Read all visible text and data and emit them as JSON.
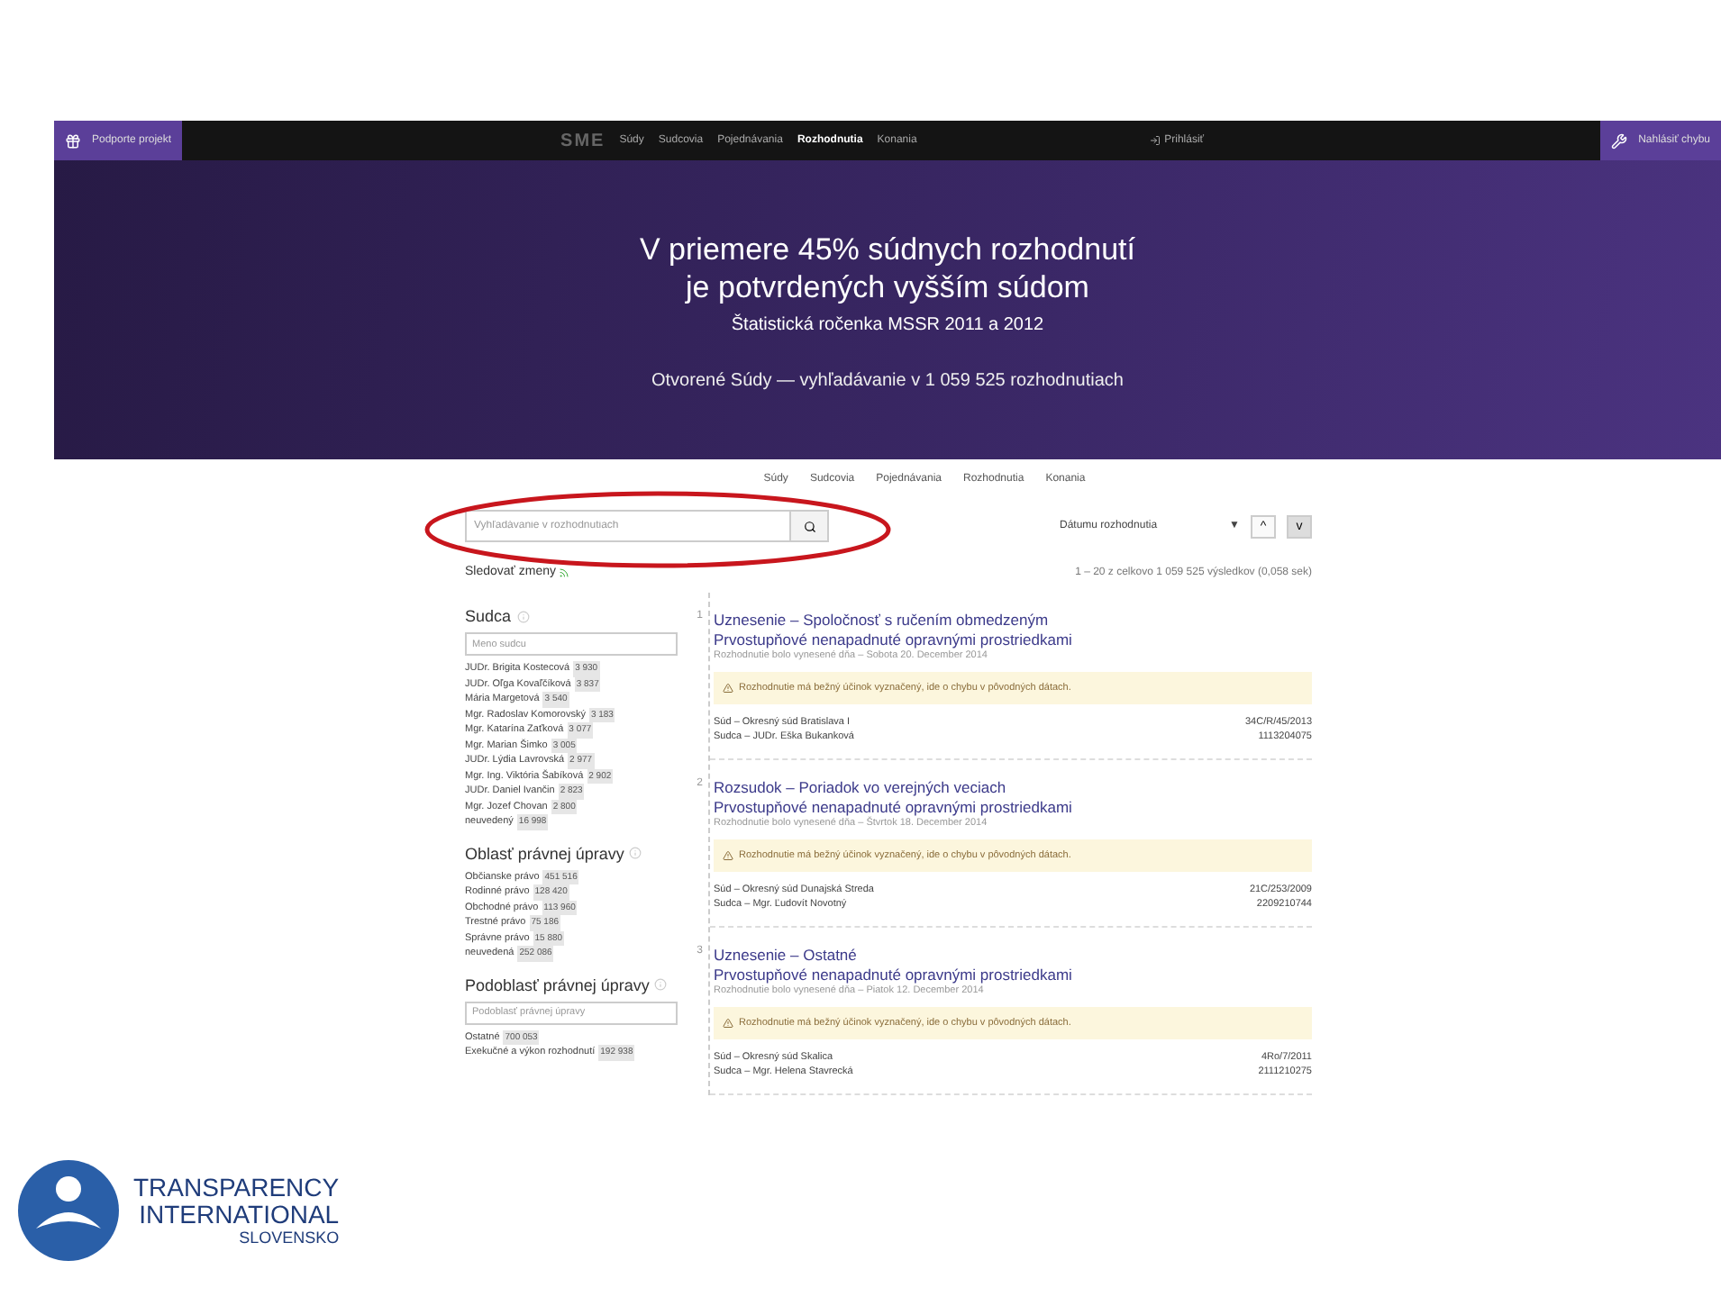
{
  "topbar": {
    "support_button": "Podporte projekt",
    "logo": "SME",
    "nav": [
      {
        "label": "Súdy",
        "selected": false
      },
      {
        "label": "Sudcovia",
        "selected": false
      },
      {
        "label": "Pojednávania",
        "selected": false
      },
      {
        "label": "Rozhodnutia",
        "selected": true
      },
      {
        "label": "Konania",
        "selected": false
      }
    ],
    "login": "Prihlásiť",
    "report_button": "Nahlásiť chybu"
  },
  "hero": {
    "title_lines": [
      "V priemere 45% súdnych rozhodnutí",
      "je potvrdených vyšším súdom"
    ],
    "source": "Štatistická ročenka MSSR 2011 a 2012",
    "tagline": "Otvorené Súdy — vyhľadávanie v 1 059 525 rozhodnutiach"
  },
  "subnav": [
    {
      "label": "Súdy",
      "selected": false
    },
    {
      "label": "Sudcovia",
      "selected": false
    },
    {
      "label": "Pojednávania",
      "selected": false
    },
    {
      "label": "Rozhodnutia",
      "selected": false
    },
    {
      "label": "Konania",
      "selected": false
    }
  ],
  "search": {
    "placeholder": "Vyhľadávanie v rozhodnutiach",
    "follow": "Sledovať zmeny"
  },
  "sort": {
    "value": "Dátumu rozhodnutia",
    "caret": "▼",
    "directions": [
      {
        "label": "^",
        "selected": false
      },
      {
        "label": "v",
        "selected": true
      }
    ]
  },
  "result_count": "1 – 20 z celkovo 1 059 525 výsledkov (0,058 sek)",
  "facets": [
    {
      "title": "Sudca",
      "placeholder": "Meno sudcu",
      "items": [
        {
          "label": "JUDr. Brigita Kostecová",
          "count": "3 930"
        },
        {
          "label": "JUDr. Oľga Kovaľčíková",
          "count": "3 837"
        },
        {
          "label": "Mária Margetová",
          "count": "3 540"
        },
        {
          "label": "Mgr. Radoslav Komorovský",
          "count": "3 183"
        },
        {
          "label": "Mgr. Katarína Zaťková",
          "count": "3 077"
        },
        {
          "label": "Mgr. Marian Šimko",
          "count": "3 005"
        },
        {
          "label": "JUDr. Lýdia Lavrovská",
          "count": "2 977"
        },
        {
          "label": "Mgr. Ing. Viktória Šabíková",
          "count": "2 902"
        },
        {
          "label": "JUDr. Daniel Ivančin",
          "count": "2 823"
        },
        {
          "label": "Mgr. Jozef Chovan",
          "count": "2 800"
        },
        {
          "label": "neuvedený",
          "count": "16 998"
        }
      ]
    },
    {
      "title": "Oblasť právnej úpravy",
      "items": [
        {
          "label": "Občianske právo",
          "count": "451 516"
        },
        {
          "label": "Rodinné právo",
          "count": "128 420"
        },
        {
          "label": "Obchodné právo",
          "count": "113 960"
        },
        {
          "label": "Trestné právo",
          "count": "75 186"
        },
        {
          "label": "Správne právo",
          "count": "15 880"
        },
        {
          "label": "neuvedená",
          "count": "252 086"
        }
      ]
    },
    {
      "title": "Podoblasť právnej úpravy",
      "placeholder": "Podoblasť právnej úpravy",
      "items": [
        {
          "label": "Ostatné",
          "count": "700 053"
        },
        {
          "label": "Exekučné a výkon rozhodnutí",
          "count": "192 938"
        }
      ]
    }
  ],
  "results": [
    {
      "number": "1",
      "title": "Uznesenie – Spoločnosť s ručením obmedzeným",
      "subtitle": "Prvostupňové nenapadnuté opravnými prostriedkami",
      "date": "Rozhodnutie bolo vynesené dňa – Sobota 20. December 2014",
      "warning": "Rozhodnutie má bežný účinok vyznačený, ide o chybu v pôvodných dátach.",
      "court": "Súd – Okresný súd Bratislava I",
      "judge": "Sudca – JUDr. Eška Bukanková",
      "file_no": "34C/R/45/2013",
      "ecli": "1113204075"
    },
    {
      "number": "2",
      "title": "Rozsudok – Poriadok vo verejných veciach",
      "subtitle": "Prvostupňové nenapadnuté opravnými prostriedkami",
      "date": "Rozhodnutie bolo vynesené dňa – Štvrtok 18. December 2014",
      "warning": "Rozhodnutie má bežný účinok vyznačený, ide o chybu v pôvodných dátach.",
      "court": "Súd – Okresný súd Dunajská Streda",
      "judge": "Sudca – Mgr. Ľudovít Novotný",
      "file_no": "21C/253/2009",
      "ecli": "2209210744"
    },
    {
      "number": "3",
      "title": "Uznesenie – Ostatné",
      "subtitle": "Prvostupňové nenapadnuté opravnými prostriedkami",
      "date": "Rozhodnutie bolo vynesené dňa – Piatok 12. December 2014",
      "warning": "Rozhodnutie má bežný účinok vyznačený, ide o chybu v pôvodných dátach.",
      "court": "Súd – Okresný súd Skalica",
      "judge": "Sudca – Mgr. Helena Stavrecká",
      "file_no": "4Ro/7/2011",
      "ecli": "2111210275"
    }
  ],
  "logo": {
    "lines": [
      "TRANSPARENCY",
      "INTERNATIONAL",
      "SLOVENSKO"
    ]
  }
}
